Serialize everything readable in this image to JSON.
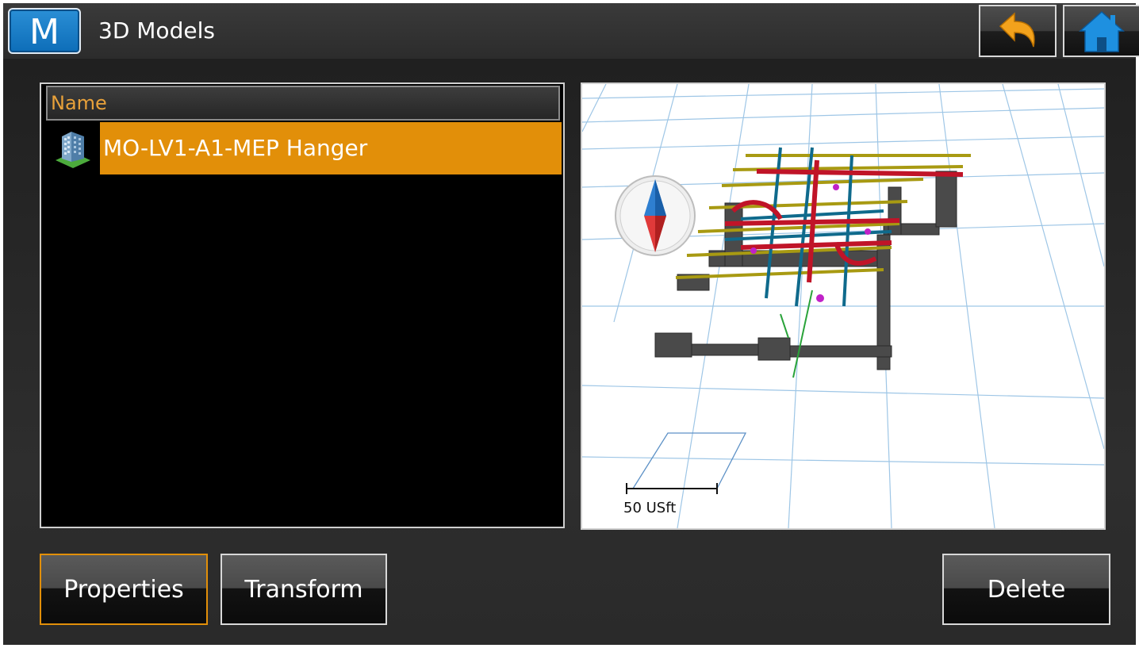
{
  "header": {
    "app_logo_letter": "M",
    "title": "3D Models",
    "back_icon": "undo-arrow-icon",
    "home_icon": "home-icon"
  },
  "model_list": {
    "column_header": "Name",
    "items": [
      {
        "icon": "building-icon",
        "label": "MO-LV1-A1-MEP Hanger",
        "selected": true
      }
    ]
  },
  "viewer": {
    "compass_icon": "compass-icon",
    "scale_label": "50 USft"
  },
  "buttons": {
    "properties": "Properties",
    "transform": "Transform",
    "delete": "Delete"
  },
  "colors": {
    "accent": "#e28f09",
    "header_text": "#e8a13a",
    "logo_blue": "#0d6db8"
  }
}
